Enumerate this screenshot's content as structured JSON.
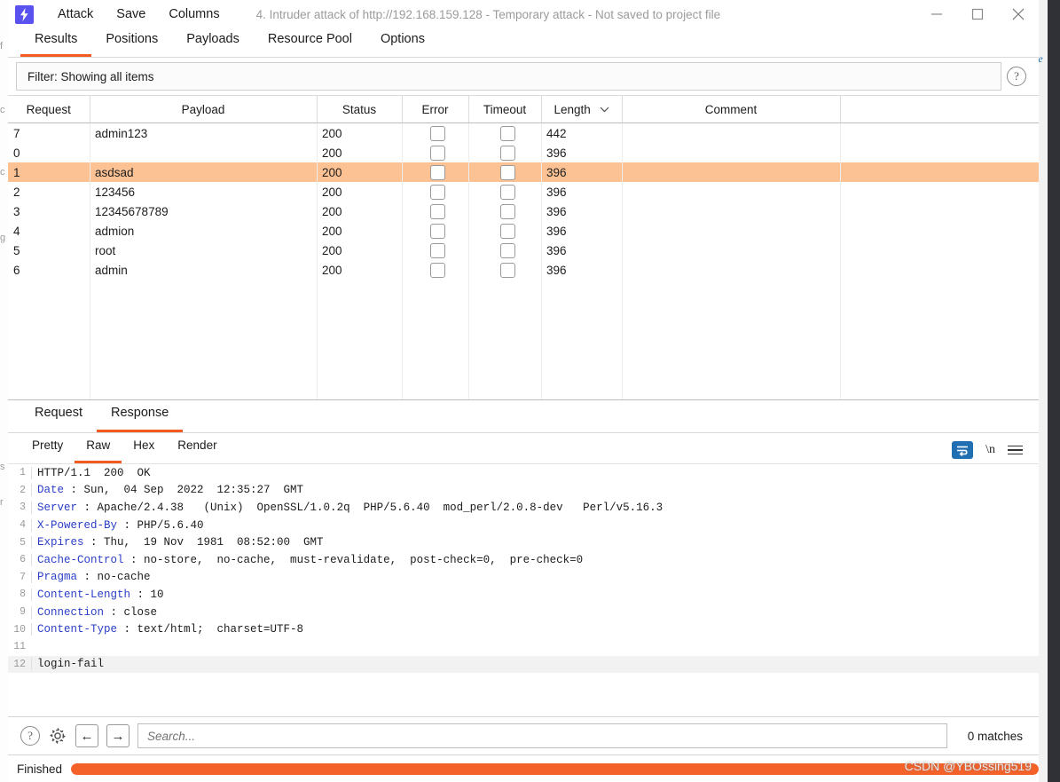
{
  "window": {
    "app_icon": "burp-lightning-icon",
    "title": "4. Intruder attack of http://192.168.159.128 - Temporary attack - Not saved to project file",
    "menus": [
      "Attack",
      "Save",
      "Columns"
    ],
    "controls": {
      "minimize": "minimize-icon",
      "maximize": "maximize-icon",
      "close": "close-icon"
    }
  },
  "tabs": {
    "items": [
      "Results",
      "Positions",
      "Payloads",
      "Resource Pool",
      "Options"
    ],
    "active": "Results"
  },
  "filter": {
    "text": "Filter: Showing all items",
    "help_icon": "?"
  },
  "results_table": {
    "columns": [
      "Request",
      "Payload",
      "Status",
      "Error",
      "Timeout",
      "Length",
      "Comment"
    ],
    "sorted_column": "Length",
    "sort_caret": "chevron-down-icon",
    "selected_row_index": 2,
    "rows": [
      {
        "request": "7",
        "payload": "admin123",
        "status": "200",
        "error": false,
        "timeout": false,
        "length": "442",
        "comment": ""
      },
      {
        "request": "0",
        "payload": "",
        "status": "200",
        "error": false,
        "timeout": false,
        "length": "396",
        "comment": ""
      },
      {
        "request": "1",
        "payload": "asdsad",
        "status": "200",
        "error": false,
        "timeout": false,
        "length": "396",
        "comment": ""
      },
      {
        "request": "2",
        "payload": "123456",
        "status": "200",
        "error": false,
        "timeout": false,
        "length": "396",
        "comment": ""
      },
      {
        "request": "3",
        "payload": "12345678789",
        "status": "200",
        "error": false,
        "timeout": false,
        "length": "396",
        "comment": ""
      },
      {
        "request": "4",
        "payload": "admion",
        "status": "200",
        "error": false,
        "timeout": false,
        "length": "396",
        "comment": ""
      },
      {
        "request": "5",
        "payload": "root",
        "status": "200",
        "error": false,
        "timeout": false,
        "length": "396",
        "comment": ""
      },
      {
        "request": "6",
        "payload": "admin",
        "status": "200",
        "error": false,
        "timeout": false,
        "length": "396",
        "comment": ""
      }
    ]
  },
  "message_tabs": {
    "items": [
      "Request",
      "Response"
    ],
    "active": "Response"
  },
  "view_tabs": {
    "items": [
      "Pretty",
      "Raw",
      "Hex",
      "Render"
    ],
    "active": "Raw",
    "tools": {
      "wrap_icon": "word-wrap-icon",
      "newline_label": "\\n",
      "menu_icon": "hamburger-menu-icon"
    }
  },
  "response": {
    "lines": [
      {
        "n": "1",
        "name": "",
        "value": "HTTP/1.1  200  OK",
        "body": false
      },
      {
        "n": "2",
        "name": "Date",
        "value": " : Sun,  04 Sep  2022  12:35:27  GMT",
        "body": false
      },
      {
        "n": "3",
        "name": "Server",
        "value": " : Apache/2.4.38   (Unix)  OpenSSL/1.0.2q  PHP/5.6.40  mod_perl/2.0.8-dev   Perl/v5.16.3",
        "body": false
      },
      {
        "n": "4",
        "name": "X-Powered-By",
        "value": " : PHP/5.6.40",
        "body": false
      },
      {
        "n": "5",
        "name": "Expires",
        "value": " : Thu,  19 Nov  1981  08:52:00  GMT",
        "body": false
      },
      {
        "n": "6",
        "name": "Cache-Control",
        "value": " : no-store,  no-cache,  must-revalidate,  post-check=0,  pre-check=0",
        "body": false
      },
      {
        "n": "7",
        "name": "Pragma",
        "value": " : no-cache",
        "body": false
      },
      {
        "n": "8",
        "name": "Content-Length",
        "value": " : 10",
        "body": false
      },
      {
        "n": "9",
        "name": "Connection",
        "value": " : close",
        "body": false
      },
      {
        "n": "10",
        "name": "Content-Type",
        "value": " : text/html;  charset=UTF-8",
        "body": false
      },
      {
        "n": "11",
        "name": "",
        "value": "",
        "body": false
      },
      {
        "n": "12",
        "name": "",
        "value": "login-fail",
        "body": true
      }
    ]
  },
  "search": {
    "placeholder": "Search...",
    "value": "",
    "help_icon": "?",
    "settings_icon": "gear-icon",
    "prev_icon": "←",
    "next_icon": "→",
    "matches": "0 matches"
  },
  "status": {
    "label": "Finished",
    "progress_percent": 100,
    "watermark": "CSDN @YBOssing519"
  },
  "colors": {
    "accent": "#f25a1f",
    "selection": "#fcc294",
    "progress": "#f4622a",
    "header_name": "#2a3ec7",
    "app_icon_bg": "#5a52ef"
  }
}
